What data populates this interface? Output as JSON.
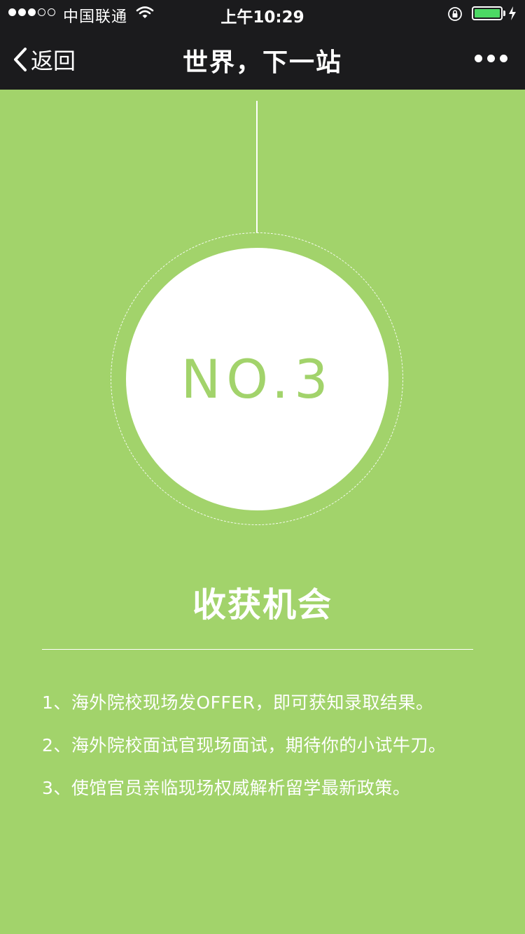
{
  "status_bar": {
    "signal_bars_filled": 3,
    "signal_bars_total": 5,
    "carrier": "中国联通",
    "time": "上午10:29",
    "battery_level": 1.0,
    "battery_color": "#4cd964"
  },
  "navbar": {
    "back_label": "返回",
    "title": "世界，下一站"
  },
  "hero": {
    "label": "NO.3"
  },
  "section": {
    "title": "收获机会",
    "items": [
      "1、海外院校现场发OFFER，即可获知录取结果。",
      "2、海外院校面试官现场面试，期待你的小试牛刀。",
      "3、使馆官员亲临现场权威解析留学最新政策。"
    ]
  },
  "colors": {
    "background": "#a2d36b",
    "topbar": "#1b1b1d",
    "accent_text": "#a2d36b"
  },
  "icons": {
    "back": "chevron-left-icon",
    "more": "more-dots-icon",
    "wifi": "wifi-icon",
    "lock": "orientation-lock-icon",
    "charging": "charging-bolt-icon"
  }
}
